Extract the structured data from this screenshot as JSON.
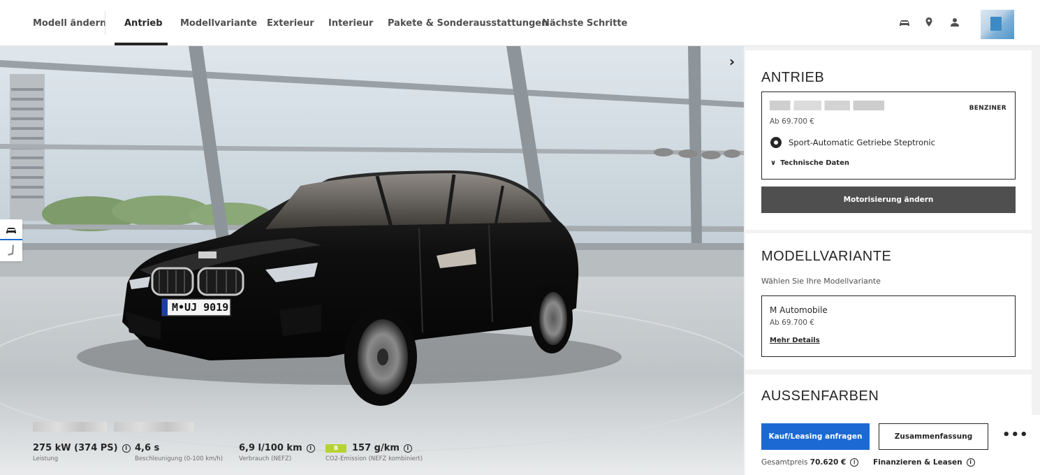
{
  "nav": {
    "items": [
      {
        "label": "Modell ändern",
        "active": false
      },
      {
        "label": "Antrieb",
        "active": true
      },
      {
        "label": "Modellvariante",
        "active": false
      },
      {
        "label": "Exterieur",
        "active": false
      },
      {
        "label": "Interieur",
        "active": false
      },
      {
        "label": "Pakete & Sonderausstattungen",
        "active": false
      },
      {
        "label": "Nächste Schritte",
        "active": false
      }
    ],
    "icons": [
      "car-icon",
      "location-pin-icon",
      "user-icon",
      "avatar"
    ]
  },
  "stage": {
    "plate": "M•UJ 9019",
    "next_icon": "chevron-right-icon",
    "side_tools": [
      "car-exterior-icon",
      "seat-interior-icon"
    ]
  },
  "keyfacts": [
    {
      "value": "275 kW (374 PS)",
      "label": "Leistung",
      "info": true
    },
    {
      "value": "4,6 s",
      "label": "Beschleunigung (0-100 km/h)",
      "info": false
    },
    {
      "value": "6,9 l/100 km",
      "label": "Verbrauch (NEFZ)",
      "info": true
    },
    {
      "value": "157 g/km",
      "label": "CO2-Emission (NEFZ kombiniert)",
      "info": true,
      "badge": "B"
    }
  ],
  "antrieb": {
    "title": "ANTRIEB",
    "fuel": "BENZINER",
    "price": "Ab 69.700 €",
    "transmission": "Sport-Automatic Getriebe Steptronic",
    "tech_data": "Technische Daten",
    "change_button": "Motorisierung ändern"
  },
  "modellvariante": {
    "title": "MODELLVARIANTE",
    "subtitle": "Wählen Sie Ihre Modellvariante",
    "variant_name": "M Automobile",
    "variant_price": "Ab 69.700 €",
    "details_link": "Mehr Details"
  },
  "aussenfarben": {
    "title": "AUSSENFARBEN"
  },
  "actions": {
    "primary": "Kauf/Leasing anfragen",
    "secondary": "Zusammenfassung",
    "more": "•••",
    "total_label": "Gesamtpreis",
    "total_value": "70.620 €",
    "finance": "Finanzieren & Leasen"
  },
  "colors": {
    "accent_blue": "#1c69d4",
    "dark_button": "#4f4f4f",
    "eco_green": "#b7d333",
    "car_body": "#121212"
  }
}
